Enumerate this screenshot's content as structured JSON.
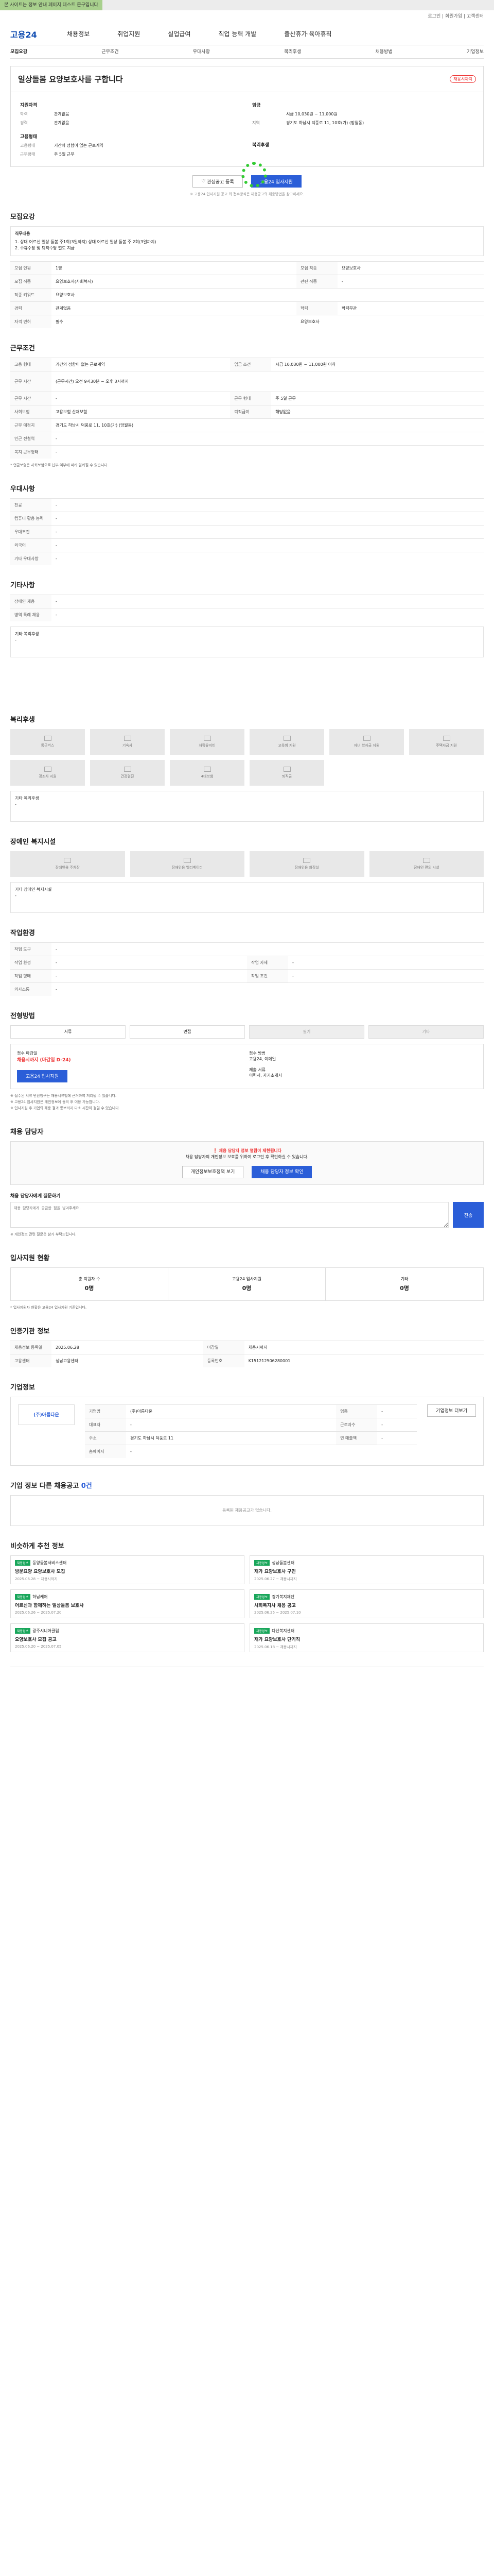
{
  "banner": {
    "text": "본 사이트는 정보 안내 페이지 테스트 문구입니다"
  },
  "util": {
    "text": "로그인 | 회원가입 | 고객센터"
  },
  "logo": {
    "text": "고용24"
  },
  "gnb": {
    "items": [
      "채용정보",
      "취업지원",
      "실업급여",
      "직업 능력 개발",
      "출산휴가·육아휴직"
    ]
  },
  "tabs": {
    "items": [
      "모집요강",
      "근무조건",
      "우대사항",
      "복리후생",
      "채용방법",
      "기업정보"
    ]
  },
  "job": {
    "title": "일상돌봄 요양보호사를 구합니다",
    "badge": "채용시까지",
    "company_h": "지원자격",
    "k_edu": "학력",
    "v_edu": "관계없음",
    "k_exp": "경력",
    "v_exp": "관계없음",
    "pay_h": "임금",
    "v_pay": "시급 10,030원 ~ 11,000원",
    "k_area": "지역",
    "v_area": "경기도 하남시 덕풍로 11, 10호(가) (망월동)",
    "emp_h": "고용형태",
    "k_emp": "고용형태",
    "v_emp": "기간의 정함이 없는 근로계약",
    "k_time": "근무형태",
    "v_time": "주 5일 근무",
    "welfare_h": "복리후생"
  },
  "actions": {
    "save": "관심공고 등록",
    "apply": "고용24 입사지원",
    "note": "※ 고용24 입사지원 공고 외 접수방식은 채용공고의 채용방법을 참고하세요."
  },
  "recruit": {
    "title": "모집요강",
    "duty_h": "직무내용",
    "duty": "1. 상대 어르신 일상 돌봄 주1회(3일까지) 상대 어르신 일상 돌봄 주 2회(3일까지)\n2. 주휴수당 및 퇴직수당 별도 지급",
    "rows": [
      [
        "모집 인원",
        "1명",
        "모집 직종",
        "요양보호사"
      ],
      [
        "모집 직종",
        "요양보호사(사회복지)",
        "관련 직종",
        "-"
      ],
      [
        "직종 키워드",
        "요양보호사",
        "",
        " "
      ],
      [
        "경력",
        "관계없음",
        "학력",
        "학력무관"
      ],
      [
        "자격 면허",
        "필수",
        "요양보호사",
        ""
      ]
    ]
  },
  "work": {
    "title": "근무조건",
    "rows": [
      [
        "고용 형태",
        "기간의 정함이 없는 근로계약",
        "임금 조건",
        "시급 10,030원 ~ 11,000원 이하"
      ],
      [
        "근무 시간",
        "(근무시간) 오전 9시30분 ~ 오후 3시까지",
        "",
        ""
      ],
      [
        "근무 시간",
        "-",
        "근무 형태",
        "주 5일 근무"
      ],
      [
        "사회보험",
        "고용보험 산재보험",
        "퇴직급여",
        "해당없음"
      ],
      [
        "근무 예정지",
        "경기도 하남시 덕풍로 11, 10호(가) (망월동)",
        "",
        ""
      ],
      [
        "인근 전철역",
        "-",
        "",
        ""
      ],
      [
        "복지 근무형태",
        "-",
        "",
        ""
      ]
    ],
    "note": "* 연금보험은 사회보험으로 납부 여부에 따라 달라질 수 있습니다."
  },
  "pref": {
    "title": "우대사항",
    "rows": [
      [
        "전공",
        "-"
      ],
      [
        "컴퓨터 활용 능력",
        "-"
      ],
      [
        "우대조건",
        "-"
      ],
      [
        "외국어",
        "-"
      ],
      [
        "기타 우대사항",
        "-"
      ]
    ]
  },
  "etc": {
    "title": "기타사항",
    "rows": [
      [
        "장애인 채용",
        "-"
      ],
      [
        "병역 특례 채용",
        "-"
      ]
    ],
    "box_h": "기타 복리후생",
    "box": "-"
  },
  "welfare": {
    "title": "복리후생",
    "items": [
      "통근버스",
      "기숙사",
      "차량유지비",
      "교육비 지원",
      "자녀 학자금 지원",
      "주택자금 지원",
      "경조사 지원",
      "건강검진",
      "4대보험",
      "퇴직금",
      "",
      ""
    ],
    "box_h": "기타 복리후생",
    "box": "-"
  },
  "disabled": {
    "title": "장애인 복지시설",
    "items": [
      "장애인용 주차장",
      "장애인용 엘리베이터",
      "장애인용 화장실",
      "장애인 편의 시설"
    ],
    "box_h": "기타 장애인 복지시설",
    "box": "-"
  },
  "workplace": {
    "title": "작업환경",
    "rows": [
      [
        "작업 도구",
        "-",
        "",
        ""
      ],
      [
        "작업 환경",
        "-",
        "작업 자세",
        "-"
      ],
      [
        "작업 형태",
        "-",
        "작업 조건",
        "-"
      ],
      [
        "의사소통",
        "-",
        "",
        "  "
      ]
    ]
  },
  "method": {
    "title": "전형방법",
    "items": [
      "서류",
      "면접",
      "필기",
      "기타"
    ],
    "k_deadline": "접수 마감일",
    "v_deadline": "채용시까지 (마감일 D-24)",
    "k_how": "접수 방법",
    "v_how": "고용24, 이메일",
    "k_doc": "제출 서류",
    "v_doc": "이력서, 자기소개서",
    "apply_btn": "고용24 입사지원",
    "notes": "※ 접수된 서류 반환청구는 채용서류법에 근거하여 처리될 수 있습니다.\n※ 고용24 입사지원은 개인정보에 동의 후 이용 가능합니다.\n※ 입사지원 후 기업의 채용 결과 통보까지 다소 시간이 걸릴 수 있습니다."
  },
  "manager": {
    "title": "채용 담당자",
    "warn": "채용 담당자 정보 열람이 제한됩니다",
    "desc": "채용 담당자의 개인정보 보호를 위하여 로그인 후 확인하실 수 있습니다.",
    "btn1": "개인정보보호정책 보기",
    "btn2": "채용 담당자 정보 확인",
    "q_h": "채용 담당자에게 질문하기",
    "q_placeholder": "채용 담당자에게 궁금한 점을 남겨주세요.",
    "q_btn": "전송",
    "q_note": "※ 개인정보 관련 질문은 삼가 부탁드립니다."
  },
  "stats": {
    "title": "입사지원 현황",
    "items": [
      [
        "총 지원자 수",
        "0명"
      ],
      [
        "고용24 입사지원",
        "0명"
      ],
      [
        "기타",
        "0명"
      ]
    ],
    "note": "* 입사지원자 현황은 고용24 입사지원 기준입니다."
  },
  "org": {
    "title": "인증기관 정보",
    "rows": [
      [
        "채용정보 등록일",
        "2025.06.28",
        "마감일",
        "채용시까지"
      ],
      [
        "고용센터",
        "성남고용센터",
        "등록번호",
        "K151212506280001"
      ]
    ]
  },
  "company": {
    "title": "기업정보",
    "logo_text": "(주)아름다운",
    "rows": [
      [
        "기업명",
        "(주)아름다운",
        "업종",
        "-"
      ],
      [
        "대표자",
        "-",
        "근로자수",
        "-"
      ],
      [
        "주소",
        "경기도 하남시 덕풍로 11",
        "연 매출액",
        "-"
      ],
      [
        "홈페이지",
        "-",
        "",
        ""
      ]
    ],
    "btn": "기업정보 더보기"
  },
  "others": {
    "title": "기업 정보 다른 채용공고",
    "count": "0건",
    "empty": "등록된 채용공고가 없습니다."
  },
  "recommend": {
    "title": "비슷하게 추천 정보",
    "items": [
      {
        "tag": "채용정보",
        "org": "동양돌봄서비스센터",
        "title": "방문요양 요양보호사 모집",
        "date": "2025.06.28 ~ 채용시까지"
      },
      {
        "tag": "채용정보",
        "org": "성남돌봄센터",
        "title": "재가 요양보호사 구인",
        "date": "2025.06.27 ~ 채용시까지"
      },
      {
        "tag": "채용정보",
        "org": "하남케어",
        "title": "어르신과 함께하는 일상돌봄 보호사",
        "date": "2025.06.26 ~ 2025.07.20"
      },
      {
        "tag": "채용정보",
        "org": "경기복지재단",
        "title": "사회복지사 채용 공고",
        "date": "2025.06.25 ~ 2025.07.10"
      },
      {
        "tag": "채용정보",
        "org": "광주시니어클럽",
        "title": "요양보호사 모집 공고",
        "date": "2025.06.20 ~ 2025.07.05"
      },
      {
        "tag": "채용정보",
        "org": "다산복지센터",
        "title": "재가 요양보호사 단기직",
        "date": "2025.06.18 ~ 채용시까지"
      }
    ]
  }
}
